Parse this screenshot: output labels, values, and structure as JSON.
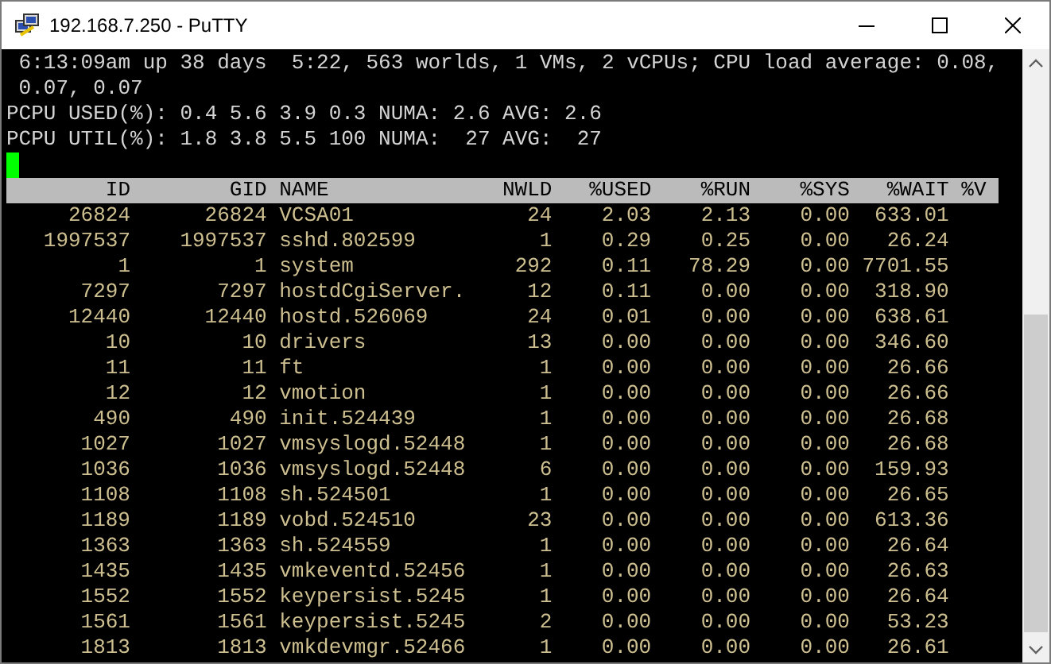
{
  "window": {
    "title": "192.168.7.250 - PuTTY"
  },
  "terminal": {
    "lines": [
      " 6:13:09am up 38 days  5:22, 563 worlds, 1 VMs, 2 vCPUs; CPU load average: 0.08,",
      " 0.07, 0.07",
      "PCPU USED(%): 0.4 5.6 3.9 0.3 NUMA: 2.6 AVG: 2.6",
      "PCPU UTIL(%): 1.8 3.8 5.5 100 NUMA:  27 AVG:  27"
    ]
  },
  "table": {
    "columns": [
      "ID",
      "GID",
      "NAME",
      "NWLD",
      "%USED",
      "%RUN",
      "%SYS",
      "%WAIT",
      "%V"
    ],
    "rows": [
      [
        "26824",
        "26824",
        "VCSA01",
        "24",
        "2.03",
        "2.13",
        "0.00",
        "633.01"
      ],
      [
        "1997537",
        "1997537",
        "sshd.802599",
        "1",
        "0.29",
        "0.25",
        "0.00",
        "26.24"
      ],
      [
        "1",
        "1",
        "system",
        "292",
        "0.11",
        "78.29",
        "0.00",
        "7701.55"
      ],
      [
        "7297",
        "7297",
        "hostdCgiServer.",
        "12",
        "0.11",
        "0.00",
        "0.00",
        "318.90"
      ],
      [
        "12440",
        "12440",
        "hostd.526069",
        "24",
        "0.01",
        "0.00",
        "0.00",
        "638.61"
      ],
      [
        "10",
        "10",
        "drivers",
        "13",
        "0.00",
        "0.00",
        "0.00",
        "346.60"
      ],
      [
        "11",
        "11",
        "ft",
        "1",
        "0.00",
        "0.00",
        "0.00",
        "26.66"
      ],
      [
        "12",
        "12",
        "vmotion",
        "1",
        "0.00",
        "0.00",
        "0.00",
        "26.66"
      ],
      [
        "490",
        "490",
        "init.524439",
        "1",
        "0.00",
        "0.00",
        "0.00",
        "26.68"
      ],
      [
        "1027",
        "1027",
        "vmsyslogd.52448",
        "1",
        "0.00",
        "0.00",
        "0.00",
        "26.68"
      ],
      [
        "1036",
        "1036",
        "vmsyslogd.52448",
        "6",
        "0.00",
        "0.00",
        "0.00",
        "159.93"
      ],
      [
        "1108",
        "1108",
        "sh.524501",
        "1",
        "0.00",
        "0.00",
        "0.00",
        "26.65"
      ],
      [
        "1189",
        "1189",
        "vobd.524510",
        "23",
        "0.00",
        "0.00",
        "0.00",
        "613.36"
      ],
      [
        "1363",
        "1363",
        "sh.524559",
        "1",
        "0.00",
        "0.00",
        "0.00",
        "26.64"
      ],
      [
        "1435",
        "1435",
        "vmkeventd.52456",
        "1",
        "0.00",
        "0.00",
        "0.00",
        "26.63"
      ],
      [
        "1552",
        "1552",
        "keypersist.5245",
        "1",
        "0.00",
        "0.00",
        "0.00",
        "26.64"
      ],
      [
        "1561",
        "1561",
        "keypersist.5245",
        "2",
        "0.00",
        "0.00",
        "0.00",
        "53.23"
      ],
      [
        "1813",
        "1813",
        "vmkdevmgr.52466",
        "1",
        "0.00",
        "0.00",
        "0.00",
        "26.61"
      ]
    ]
  }
}
